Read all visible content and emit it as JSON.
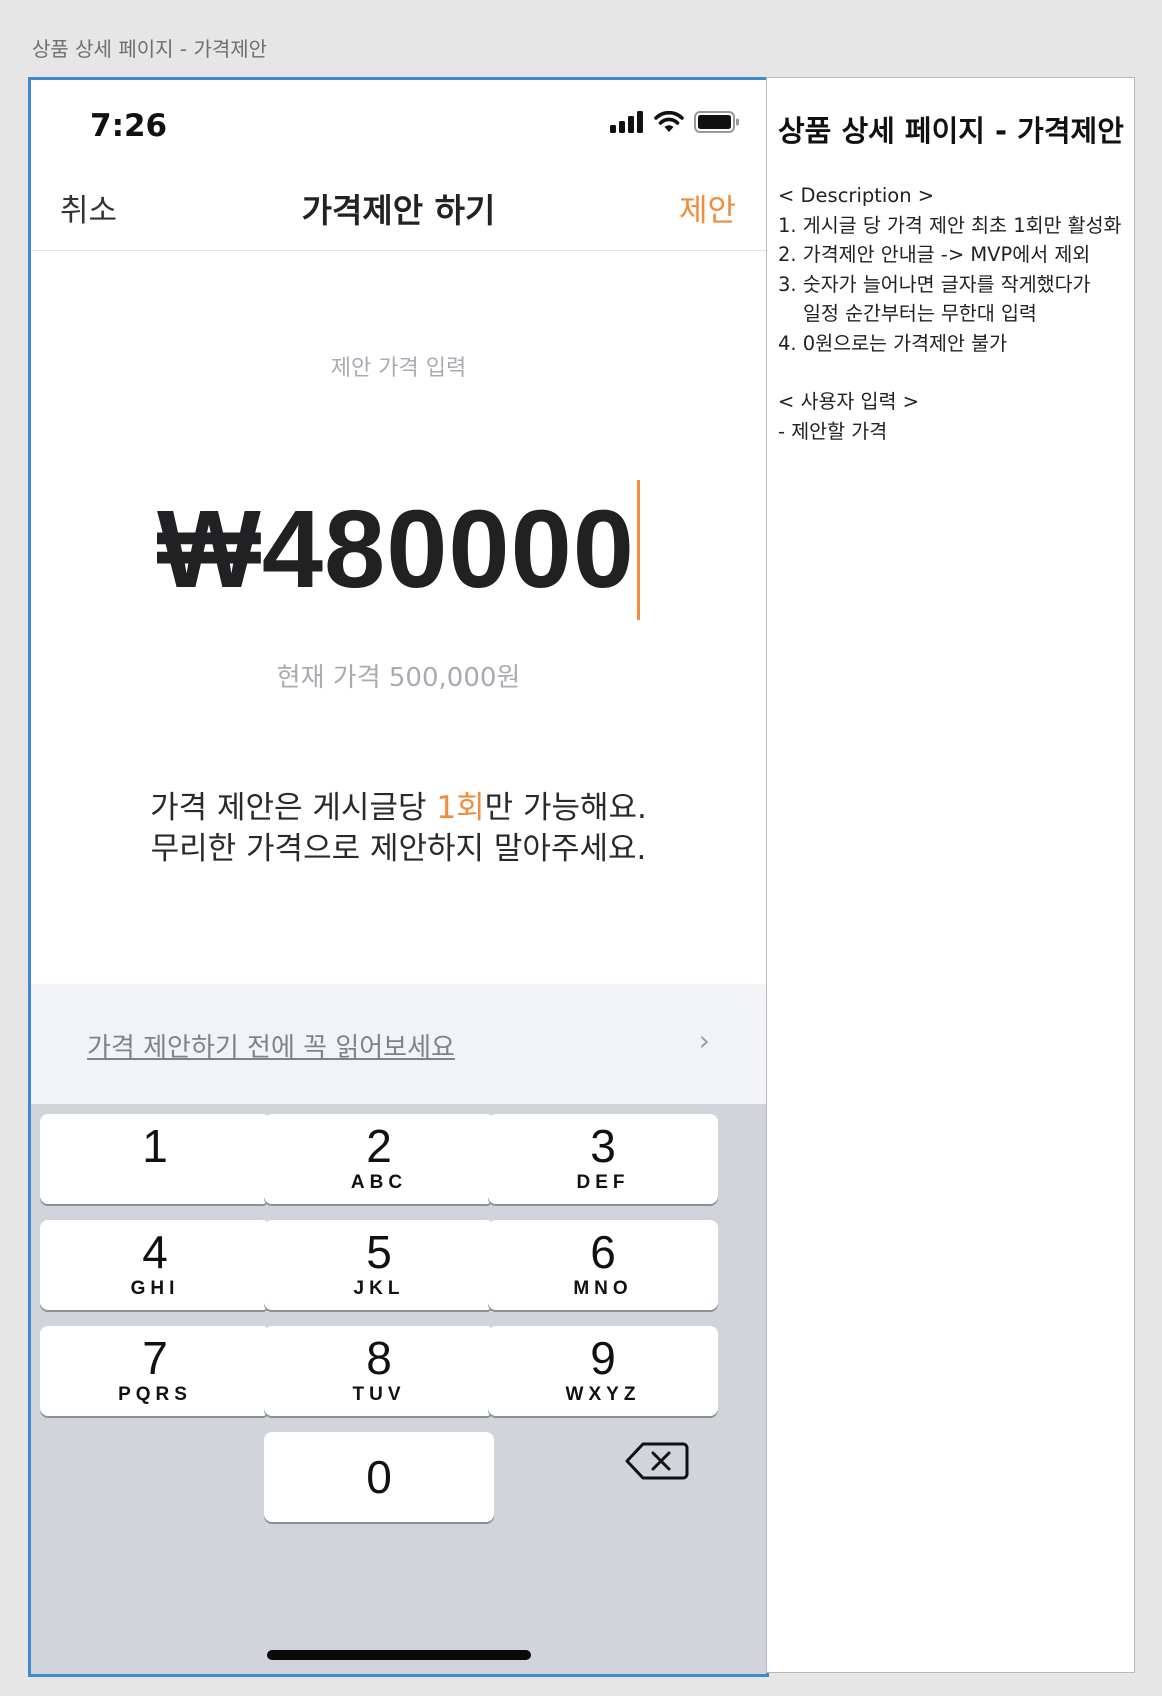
{
  "frame_title": "상품 상세 페이지 - 가격제안",
  "status_bar": {
    "time": "7:26"
  },
  "nav": {
    "cancel": "취소",
    "title": "가격제안 하기",
    "submit": "제안"
  },
  "price_input": {
    "label": "제안 가격 입력",
    "value": "₩480000",
    "current_price": "현재 가격 500,000원"
  },
  "notice": {
    "line1_before": "가격 제안은 게시글당 ",
    "line1_accent": "1회",
    "line1_after": "만 가능해요.",
    "line2": "무리한 가격으로 제안하지 말아주세요."
  },
  "guide": {
    "link": "가격 제안하기 전에 꼭 읽어보세요",
    "chevron": "›"
  },
  "keypad": {
    "keys": [
      {
        "digit": "1",
        "letters": ""
      },
      {
        "digit": "2",
        "letters": "ABC"
      },
      {
        "digit": "3",
        "letters": "DEF"
      },
      {
        "digit": "4",
        "letters": "GHI"
      },
      {
        "digit": "5",
        "letters": "JKL"
      },
      {
        "digit": "6",
        "letters": "MNO"
      },
      {
        "digit": "7",
        "letters": "PQRS"
      },
      {
        "digit": "8",
        "letters": "TUV"
      },
      {
        "digit": "9",
        "letters": "WXYZ"
      },
      {
        "digit": "0",
        "letters": ""
      }
    ],
    "backspace_icon": "backspace-icon"
  },
  "description": {
    "title": "상품 상세 페이지 - 가격제안",
    "heading": "< Description >",
    "items": [
      "1. 게시글 당 가격 제안 최초 1회만 활성화",
      "2. 가격제안 안내글 -> MVP에서 제외",
      "3. 숫자가 늘어나면 글자를 작게했다가",
      "일정 순간부터는 무한대 입력",
      "4. 0원으로는 가격제안 불가"
    ],
    "input_heading": "< 사용자 입력 >",
    "input_items": [
      "- 제안할 가격"
    ]
  },
  "colors": {
    "accent": "#f28b3b",
    "frame_border": "#3e8acb",
    "keypad_bg": "#d1d4da"
  }
}
